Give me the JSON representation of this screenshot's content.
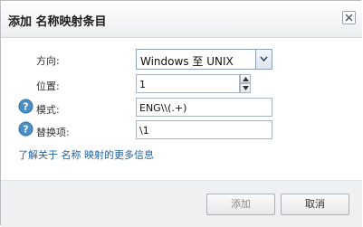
{
  "dialog": {
    "title": "添加 名称映射条目",
    "close_icon": "close-icon"
  },
  "form": {
    "direction": {
      "label": "方向:",
      "selected": "Windows 至 UNIX"
    },
    "position": {
      "label": "位置:",
      "value": "1"
    },
    "pattern": {
      "label": "模式:",
      "value": "ENG\\\\(.+)",
      "help_icon": "help-icon"
    },
    "replacement": {
      "label": "替换项:",
      "value": "\\1",
      "help_icon": "help-icon"
    },
    "learn_more_link": "了解关于 名称 映射的更多信息"
  },
  "buttons": {
    "add_label": "添加",
    "cancel_label": "取消"
  },
  "colors": {
    "link": "#1f5f9e",
    "help_icon_fill": "#4a90c8",
    "border": "#8ea2b6"
  }
}
